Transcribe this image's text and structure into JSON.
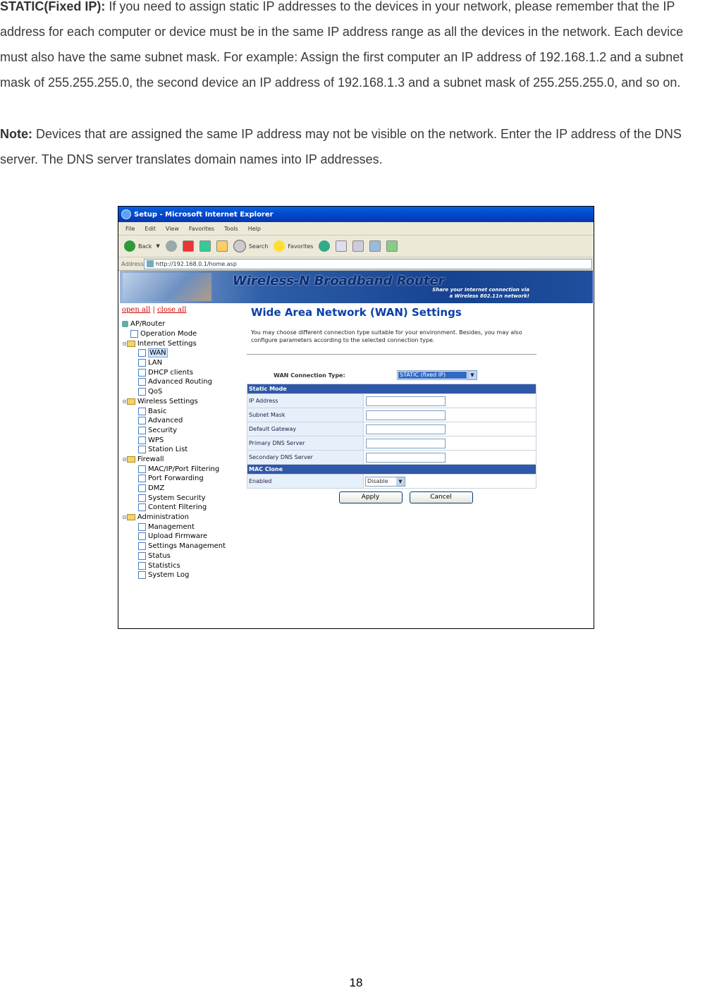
{
  "doc": {
    "p1_label": "STATIC(Fixed IP):",
    "p1_text": " If you need to assign static IP addresses to the devices in your network, please remember that the IP address for each computer or device must be in the same IP address range as all the devices in the network. Each device must also have the same subnet mask. For example: Assign the first computer an IP address of 192.168.1.2 and a subnet mask of 255.255.255.0, the second device an IP address of 192.168.1.3 and a subnet mask of 255.255.255.0, and so on.",
    "p2_label": "Note:",
    "p2_text": " Devices that are assigned the same IP address may not be visible on the network. Enter the IP address of the DNS server. The DNS server translates domain names into IP addresses.",
    "page_number": "18"
  },
  "browser": {
    "title": "Setup - Microsoft Internet Explorer",
    "menu": [
      "File",
      "Edit",
      "View",
      "Favorites",
      "Tools",
      "Help"
    ],
    "toolbar": {
      "back": "Back",
      "search": "Search",
      "favorites": "Favorites"
    },
    "address_label": "Address",
    "address_url": "http://192.168.0.1/home.asp"
  },
  "banner": {
    "title": "Wireless-N Broadband Router",
    "tagline_1": "Share your Internet connection via",
    "tagline_2": "a Wireless 802.11n network!"
  },
  "tree": {
    "open_all": "open all",
    "close_all": "close all",
    "root": "AP/Router",
    "operation_mode": "Operation Mode",
    "internet_settings": "Internet Settings",
    "internet_items": [
      "WAN",
      "LAN",
      "DHCP clients",
      "Advanced Routing",
      "QoS"
    ],
    "wireless_settings": "Wireless Settings",
    "wireless_items": [
      "Basic",
      "Advanced",
      "Security",
      "WPS",
      "Station List"
    ],
    "firewall": "Firewall",
    "firewall_items": [
      "MAC/IP/Port Filtering",
      "Port Forwarding",
      "DMZ",
      "System Security",
      "Content Filtering"
    ],
    "administration": "Administration",
    "admin_items": [
      "Management",
      "Upload Firmware",
      "Settings Management",
      "Status",
      "Statistics",
      "System Log"
    ]
  },
  "main": {
    "heading": "Wide Area Network (WAN) Settings",
    "description": "You may choose different connection type suitable for your environment. Besides, you may also configure parameters according to the selected connection type.",
    "conn_type_label": "WAN Connection Type:",
    "conn_type_value": "STATIC (fixed IP)",
    "static_mode": "Static Mode",
    "fields": [
      "IP Address",
      "Subnet Mask",
      "Default Gateway",
      "Primary DNS Server",
      "Secondary DNS Server"
    ],
    "mac_clone": "MAC Clone",
    "enabled_label": "Enabled",
    "enabled_value": "Disable",
    "apply": "Apply",
    "cancel": "Cancel"
  }
}
